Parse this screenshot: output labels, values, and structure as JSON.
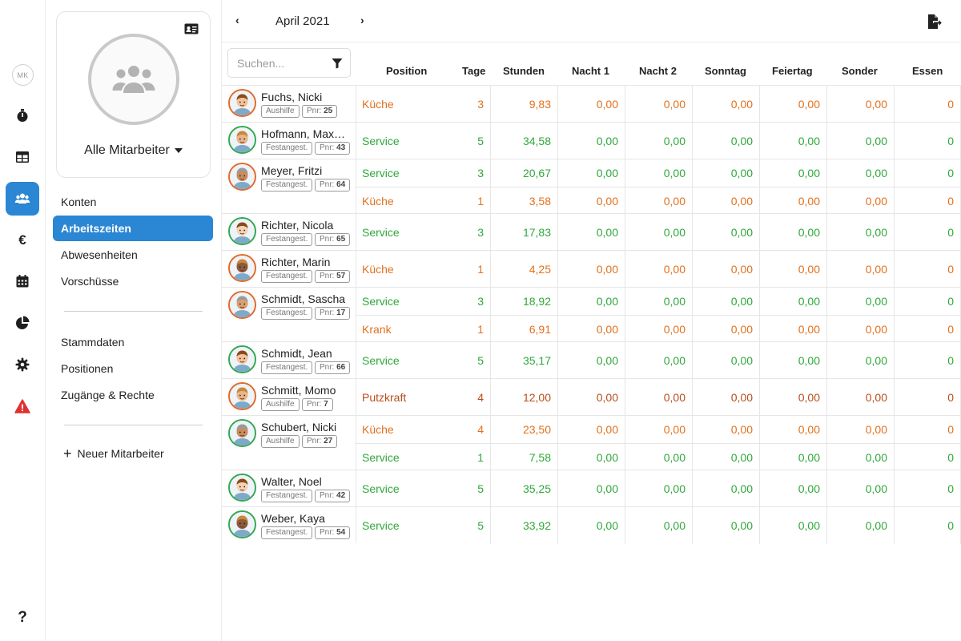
{
  "rail": {
    "avatar_initials": "MK",
    "items": [
      {
        "name": "stopwatch-icon",
        "active": false
      },
      {
        "name": "table-icon",
        "active": false
      },
      {
        "name": "users-icon",
        "active": true
      },
      {
        "name": "euro-icon",
        "active": false
      },
      {
        "name": "calendar-icon",
        "active": false
      },
      {
        "name": "pie-chart-icon",
        "active": false
      },
      {
        "name": "gear-icon",
        "active": false
      },
      {
        "name": "warning-icon",
        "active": false
      }
    ],
    "help_icon": "question-icon"
  },
  "side": {
    "group_label": "Alle Mitarbeiter",
    "nav": [
      "Konten",
      "Arbeitszeiten",
      "Abwesenheiten",
      "Vorschüsse"
    ],
    "active_nav": "Arbeitszeiten",
    "nav2": [
      "Stammdaten",
      "Positionen",
      "Zugänge & Rechte"
    ],
    "new_employee": "Neuer Mitarbeiter"
  },
  "header": {
    "prev": "‹",
    "month": "April 2021",
    "next": "›"
  },
  "search": {
    "placeholder": "Suchen..."
  },
  "columns": [
    "Position",
    "Tage",
    "Stunden",
    "Nacht 1",
    "Nacht 2",
    "Sonntag",
    "Feiertag",
    "Sonder",
    "Essen"
  ],
  "colors": {
    "orange": "#e2711d",
    "green": "#2fa83a",
    "brown": "#b94d1c",
    "accent": "#2b86d4"
  },
  "employees": [
    {
      "name": "Fuchs, Nicki",
      "type": "Aushilfe",
      "pnr": "25",
      "ring": "orange",
      "rows": [
        {
          "position": "Küche",
          "color": "orange",
          "tage": "3",
          "stunden": "9,83",
          "n1": "0,00",
          "n2": "0,00",
          "so": "0,00",
          "fe": "0,00",
          "sonder": "0,00",
          "essen": "0"
        }
      ]
    },
    {
      "name": "Hofmann, Max…",
      "type": "Festangest.",
      "pnr": "43",
      "ring": "green",
      "rows": [
        {
          "position": "Service",
          "color": "green",
          "tage": "5",
          "stunden": "34,58",
          "n1": "0,00",
          "n2": "0,00",
          "so": "0,00",
          "fe": "0,00",
          "sonder": "0,00",
          "essen": "0"
        }
      ]
    },
    {
      "name": "Meyer, Fritzi",
      "type": "Festangest.",
      "pnr": "64",
      "ring": "orange",
      "rows": [
        {
          "position": "Service",
          "color": "green",
          "tage": "3",
          "stunden": "20,67",
          "n1": "0,00",
          "n2": "0,00",
          "so": "0,00",
          "fe": "0,00",
          "sonder": "0,00",
          "essen": "0"
        },
        {
          "position": "Küche",
          "color": "orange",
          "tage": "1",
          "stunden": "3,58",
          "n1": "0,00",
          "n2": "0,00",
          "so": "0,00",
          "fe": "0,00",
          "sonder": "0,00",
          "essen": "0"
        }
      ]
    },
    {
      "name": "Richter, Nicola",
      "type": "Festangest.",
      "pnr": "65",
      "ring": "green",
      "rows": [
        {
          "position": "Service",
          "color": "green",
          "tage": "3",
          "stunden": "17,83",
          "n1": "0,00",
          "n2": "0,00",
          "so": "0,00",
          "fe": "0,00",
          "sonder": "0,00",
          "essen": "0"
        }
      ]
    },
    {
      "name": "Richter, Marin",
      "type": "Festangest.",
      "pnr": "57",
      "ring": "orange",
      "rows": [
        {
          "position": "Küche",
          "color": "orange",
          "tage": "1",
          "stunden": "4,25",
          "n1": "0,00",
          "n2": "0,00",
          "so": "0,00",
          "fe": "0,00",
          "sonder": "0,00",
          "essen": "0"
        }
      ]
    },
    {
      "name": "Schmidt, Sascha",
      "type": "Festangest.",
      "pnr": "17",
      "ring": "orange",
      "rows": [
        {
          "position": "Service",
          "color": "green",
          "tage": "3",
          "stunden": "18,92",
          "n1": "0,00",
          "n2": "0,00",
          "so": "0,00",
          "fe": "0,00",
          "sonder": "0,00",
          "essen": "0"
        },
        {
          "position": "Krank",
          "color": "orange",
          "tage": "1",
          "stunden": "6,91",
          "n1": "0,00",
          "n2": "0,00",
          "so": "0,00",
          "fe": "0,00",
          "sonder": "0,00",
          "essen": "0"
        }
      ]
    },
    {
      "name": "Schmidt, Jean",
      "type": "Festangest.",
      "pnr": "66",
      "ring": "green",
      "rows": [
        {
          "position": "Service",
          "color": "green",
          "tage": "5",
          "stunden": "35,17",
          "n1": "0,00",
          "n2": "0,00",
          "so": "0,00",
          "fe": "0,00",
          "sonder": "0,00",
          "essen": "0"
        }
      ]
    },
    {
      "name": "Schmitt, Momo",
      "type": "Aushilfe",
      "pnr": "7",
      "ring": "orange",
      "rows": [
        {
          "position": "Putzkraft",
          "color": "brown",
          "tage": "4",
          "stunden": "12,00",
          "n1": "0,00",
          "n2": "0,00",
          "so": "0,00",
          "fe": "0,00",
          "sonder": "0,00",
          "essen": "0"
        }
      ]
    },
    {
      "name": "Schubert, Nicki",
      "type": "Aushilfe",
      "pnr": "27",
      "ring": "green",
      "rows": [
        {
          "position": "Küche",
          "color": "orange",
          "tage": "4",
          "stunden": "23,50",
          "n1": "0,00",
          "n2": "0,00",
          "so": "0,00",
          "fe": "0,00",
          "sonder": "0,00",
          "essen": "0"
        },
        {
          "position": "Service",
          "color": "green",
          "tage": "1",
          "stunden": "7,58",
          "n1": "0,00",
          "n2": "0,00",
          "so": "0,00",
          "fe": "0,00",
          "sonder": "0,00",
          "essen": "0"
        }
      ]
    },
    {
      "name": "Walter, Noel",
      "type": "Festangest.",
      "pnr": "42",
      "ring": "green",
      "rows": [
        {
          "position": "Service",
          "color": "green",
          "tage": "5",
          "stunden": "35,25",
          "n1": "0,00",
          "n2": "0,00",
          "so": "0,00",
          "fe": "0,00",
          "sonder": "0,00",
          "essen": "0"
        }
      ]
    },
    {
      "name": "Weber, Kaya",
      "type": "Festangest.",
      "pnr": "54",
      "ring": "green",
      "rows": [
        {
          "position": "Service",
          "color": "green",
          "tage": "5",
          "stunden": "33,92",
          "n1": "0,00",
          "n2": "0,00",
          "so": "0,00",
          "fe": "0,00",
          "sonder": "0,00",
          "essen": "0"
        }
      ]
    }
  ]
}
